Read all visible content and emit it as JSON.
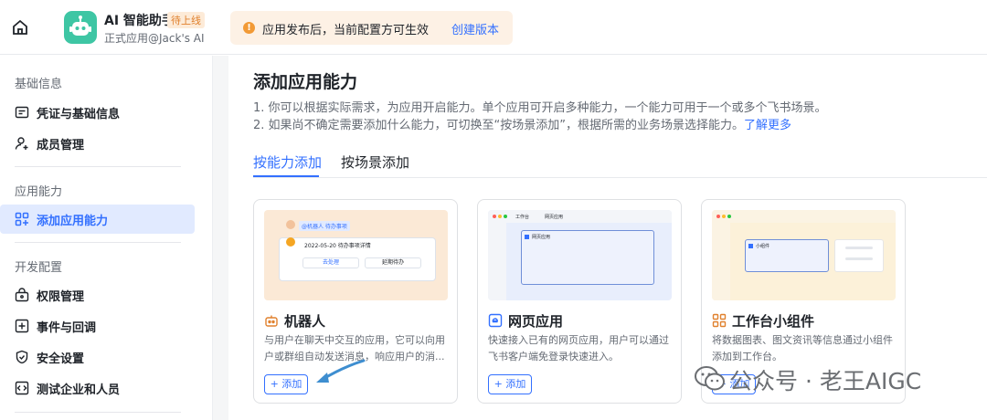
{
  "header": {
    "app_name": "AI 智能助手",
    "status_badge": "待上线",
    "app_subtitle": "正式应用@Jack's AI",
    "notice_text": "应用发布后，当前配置方可生效",
    "notice_link": "创建版本",
    "notice_icon_glyph": "!"
  },
  "sidebar": {
    "sections": [
      {
        "title": "基础信息",
        "items": [
          {
            "label": "凭证与基础信息",
            "icon": "credential-icon"
          },
          {
            "label": "成员管理",
            "icon": "member-icon"
          }
        ]
      },
      {
        "title": "应用能力",
        "items": [
          {
            "label": "添加应用能力",
            "icon": "grid-add-icon",
            "active": true
          }
        ]
      },
      {
        "title": "开发配置",
        "items": [
          {
            "label": "权限管理",
            "icon": "permission-icon"
          },
          {
            "label": "事件与回调",
            "icon": "event-icon"
          },
          {
            "label": "安全设置",
            "icon": "shield-icon"
          },
          {
            "label": "测试企业和人员",
            "icon": "code-icon"
          }
        ]
      }
    ]
  },
  "main": {
    "title": "添加应用能力",
    "desc_line1": "1. 你可以根据实际需求，为应用开启能力。单个应用可开启多种能力，一个能力可用于一个或多个飞书场景。",
    "desc_line2": "2. 如果尚不确定需要添加什么能力，可切换至“按场景添加”，根据所需的业务场景选择能力。",
    "desc_more": "了解更多",
    "tabs": [
      {
        "label": "按能力添加",
        "active": true
      },
      {
        "label": "按场景添加",
        "active": false
      }
    ],
    "cards": [
      {
        "title": "机器人",
        "icon": "robot-icon",
        "desc": "与用户在聊天中交互的应用，它可以向用户或群组自动发送消息，响应用户的消...",
        "add_label": "+ 添加",
        "preview": {
          "tag": "@机器人  待办事项",
          "line": "2022-05-20 待办事项详情",
          "btn1": "去处理",
          "btn2": "延期待办"
        }
      },
      {
        "title": "网页应用",
        "icon": "web-app-icon",
        "desc": "快速接入已有的网页应用，用户可以通过飞书客户端免登录快速进入。",
        "add_label": "+ 添加",
        "preview": {
          "tab1": "工作台",
          "tab2": "网页应用",
          "window_label": "网页应用"
        }
      },
      {
        "title": "工作台小组件",
        "icon": "widget-icon",
        "desc": "将数据图表、图文资讯等信息通过小组件添加到工作台。",
        "add_label": "+ 添加",
        "preview": {
          "widget_label": "小组件"
        }
      }
    ]
  },
  "watermark": {
    "text": "公众号 · 老王AIGC"
  },
  "colors": {
    "accent": "#3370ff",
    "active_bg": "#e1eaff",
    "notice_bg": "#fdf1e5",
    "avatar": "#3ec6a4",
    "badge": "#e0812e"
  }
}
